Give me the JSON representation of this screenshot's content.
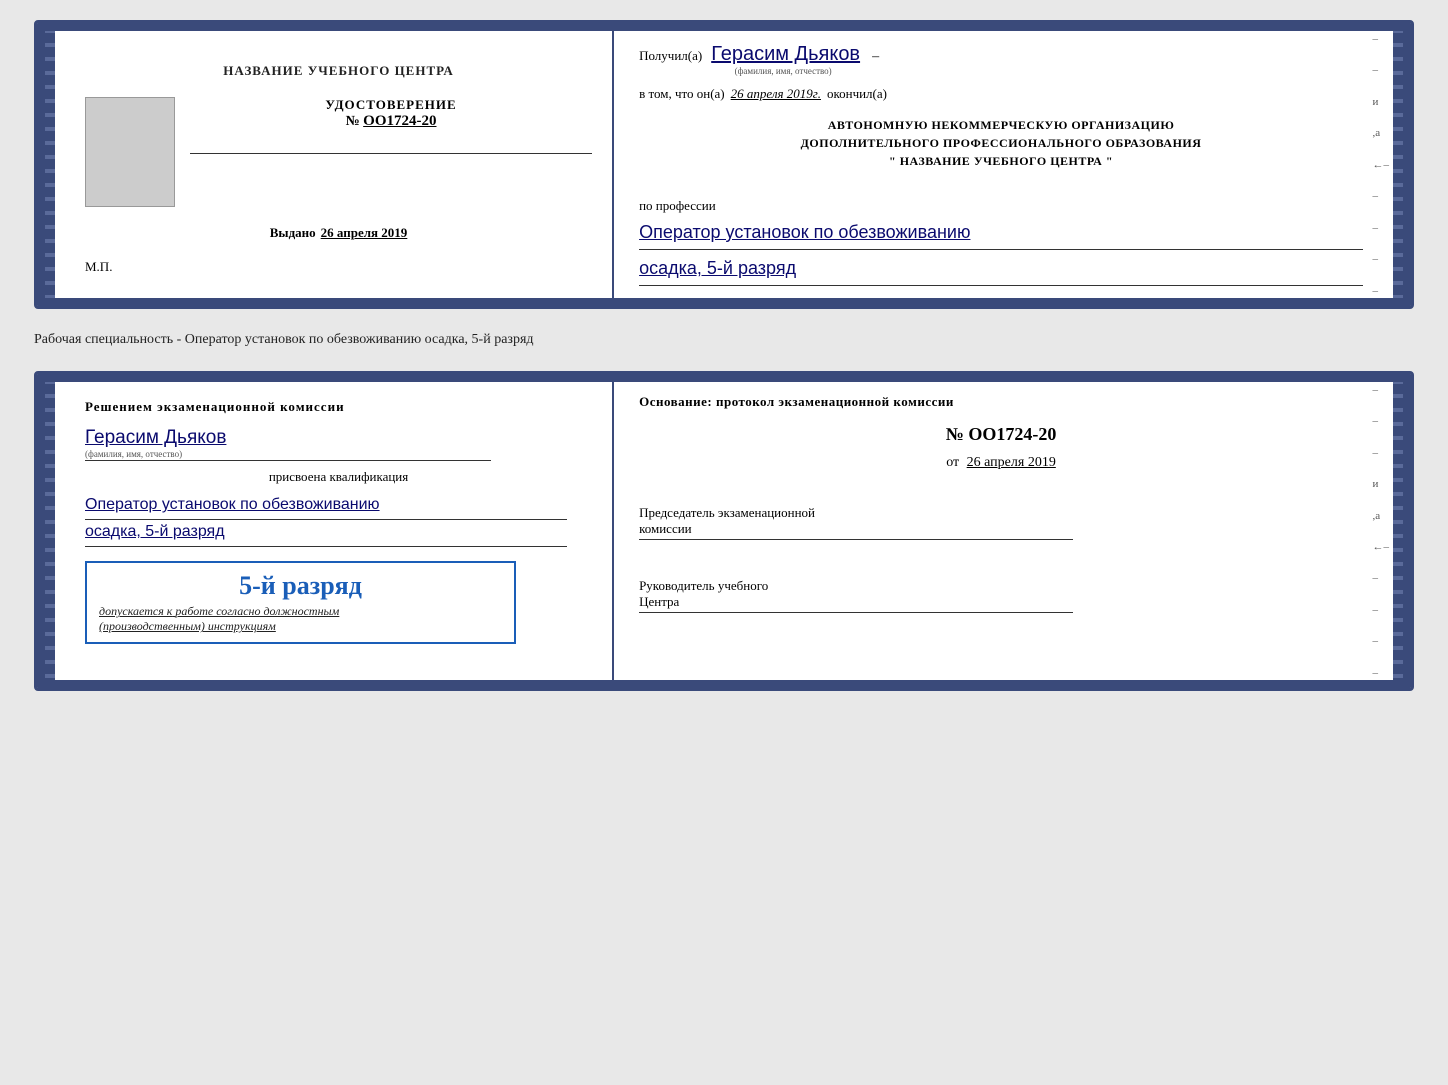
{
  "page": {
    "background": "#e8e8e8"
  },
  "cert1": {
    "left": {
      "title": "НАЗВАНИЕ УЧЕБНОГО ЦЕНТРА",
      "cert_label": "УДОСТОВЕРЕНИЕ",
      "cert_number_prefix": "№",
      "cert_number": "OO1724-20",
      "issued_label": "Выдано",
      "issued_date": "26 апреля 2019",
      "mp_label": "М.П."
    },
    "right": {
      "received_prefix": "Получил(а)",
      "recipient_name": "Герасим Дьяков",
      "fio_label": "(фамилия, имя, отчество)",
      "dash": "–",
      "in_that": "в том, что он(а)",
      "completion_date": "26 апреля 2019г.",
      "finished_label": "окончил(а)",
      "institution_line1": "АВТОНОМНУЮ НЕКОММЕРЧЕСКУЮ ОРГАНИЗАЦИЮ",
      "institution_line2": "ДОПОЛНИТЕЛЬНОГО ПРОФЕССИОНАЛЬНОГО ОБРАЗОВАНИЯ",
      "institution_line3": "\"   НАЗВАНИЕ УЧЕБНОГО ЦЕНТРА   \"",
      "profession_prefix": "по профессии",
      "profession_value": "Оператор установок по обезвоживанию",
      "profession_sub": "осадка, 5-й разряд"
    }
  },
  "separator": {
    "text": "Рабочая специальность - Оператор установок по обезвоживанию осадка, 5-й разряд"
  },
  "cert2": {
    "left": {
      "decision_title": "Решением экзаменационной комиссии",
      "name": "Герасим Дьяков",
      "fio_label": "(фамилия, имя, отчество)",
      "assigned_label": "присвоена квалификация",
      "qualification1": "Оператор установок по обезвоживанию",
      "qualification2": "осадка, 5-й разряд",
      "stamp_rank": "5-й разряд",
      "stamp_text_prefix": "допускается к",
      "stamp_text_main": "работе согласно должностным",
      "stamp_text_end": "(производственным) инструкциям"
    },
    "right": {
      "basis_label": "Основание: протокол экзаменационной комиссии",
      "protocol_number": "№  OO1724-20",
      "date_prefix": "от",
      "date_value": "26 апреля 2019",
      "chairman_label": "Председатель экзаменационной",
      "chairman_label2": "комиссии",
      "head_label": "Руководитель учебного",
      "head_label2": "Центра"
    }
  }
}
